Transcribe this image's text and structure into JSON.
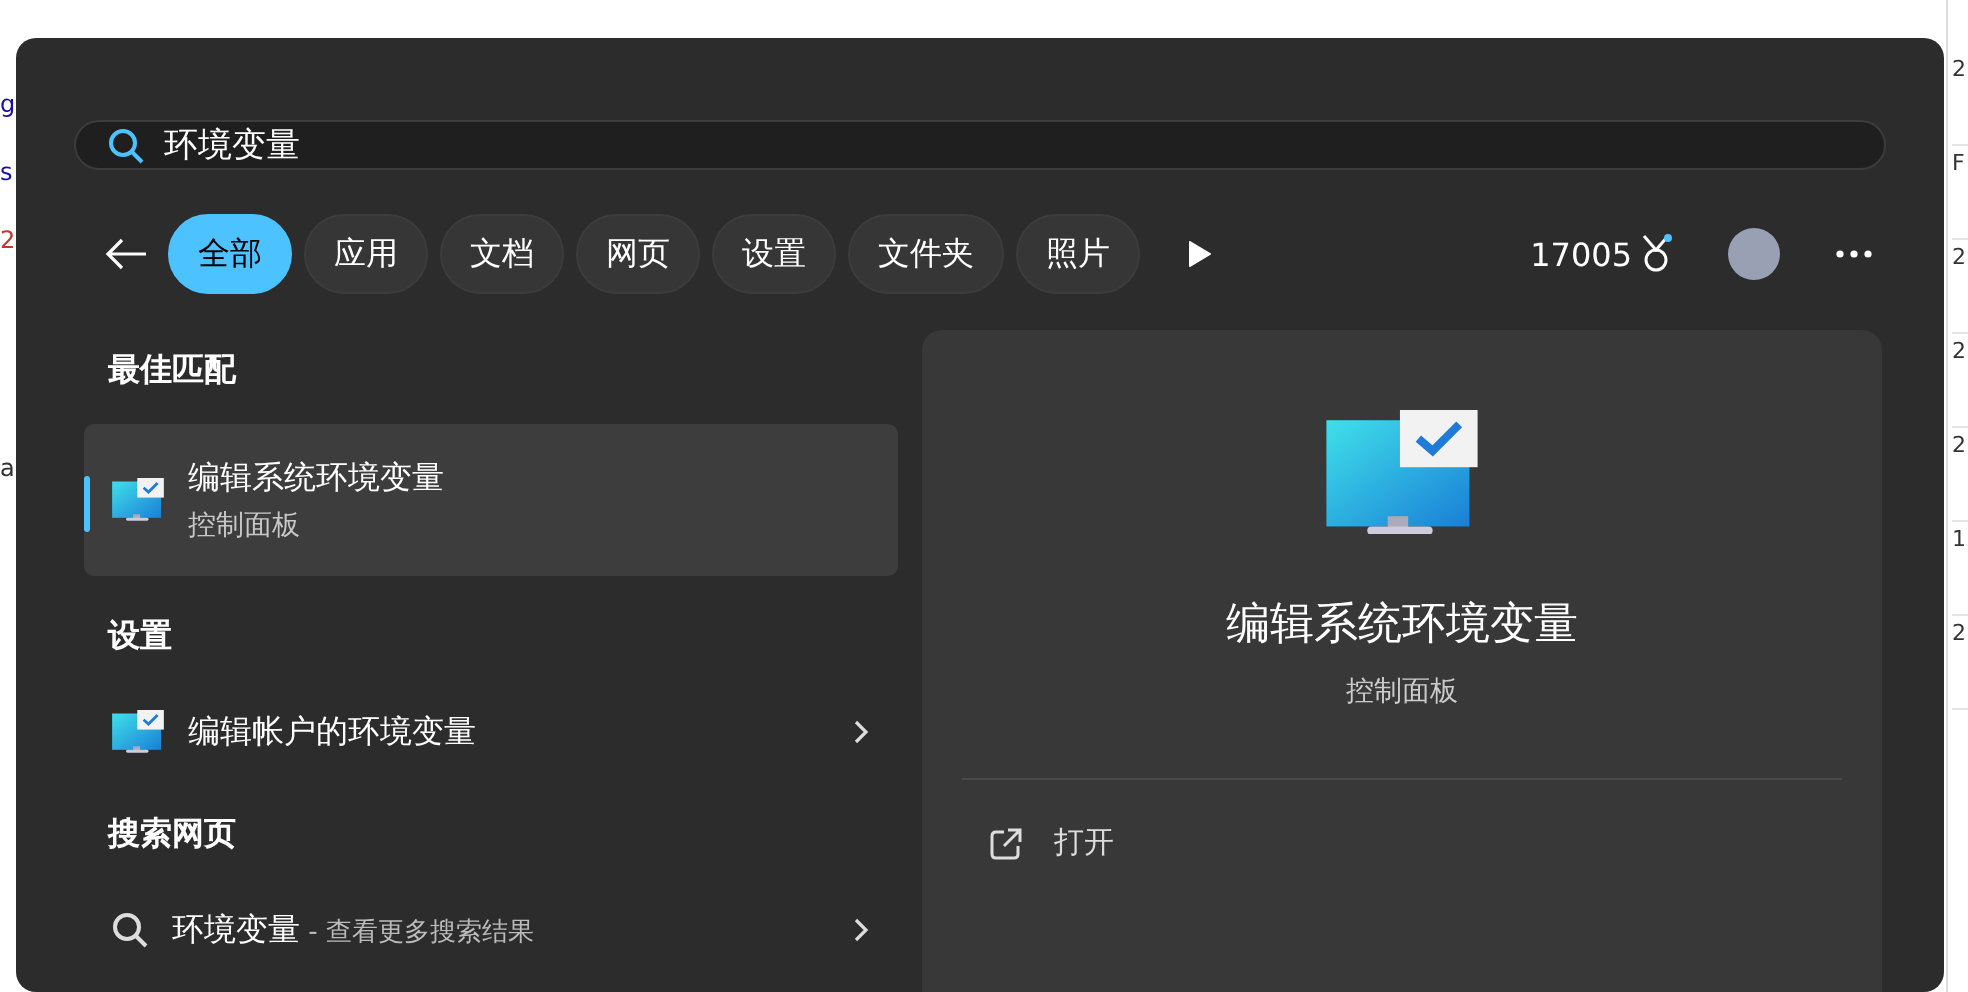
{
  "background_page": {
    "left_fragments": [
      {
        "text": "g",
        "kind": "link"
      },
      {
        "text": "s",
        "kind": "link"
      },
      {
        "text": "2",
        "kind": "alert"
      },
      {
        "text": "a",
        "kind": "plain"
      }
    ],
    "right_fragments": [
      "2",
      "F",
      "2",
      "2",
      "2",
      "1",
      "2"
    ]
  },
  "search": {
    "value": "环境变量"
  },
  "filters": [
    {
      "label": "全部",
      "selected": true
    },
    {
      "label": "应用",
      "selected": false
    },
    {
      "label": "文档",
      "selected": false
    },
    {
      "label": "网页",
      "selected": false
    },
    {
      "label": "设置",
      "selected": false
    },
    {
      "label": "文件夹",
      "selected": false
    },
    {
      "label": "照片",
      "selected": false
    }
  ],
  "points": "17005",
  "sections": [
    {
      "heading": "最佳匹配",
      "items": [
        {
          "kind": "app",
          "title": "编辑系统环境变量",
          "subtitle": "控制面板",
          "selected": true
        }
      ]
    },
    {
      "heading": "设置",
      "items": [
        {
          "kind": "setting",
          "title": "编辑帐户的环境变量",
          "selected": false
        }
      ]
    },
    {
      "heading": "搜索网页",
      "items": [
        {
          "kind": "web",
          "title": "环境变量",
          "suffix": " - 查看更多搜索结果",
          "selected": false
        }
      ]
    }
  ],
  "preview": {
    "title": "编辑系统环境变量",
    "subtitle": "控制面板",
    "actions": [
      {
        "label": "打开"
      }
    ]
  }
}
